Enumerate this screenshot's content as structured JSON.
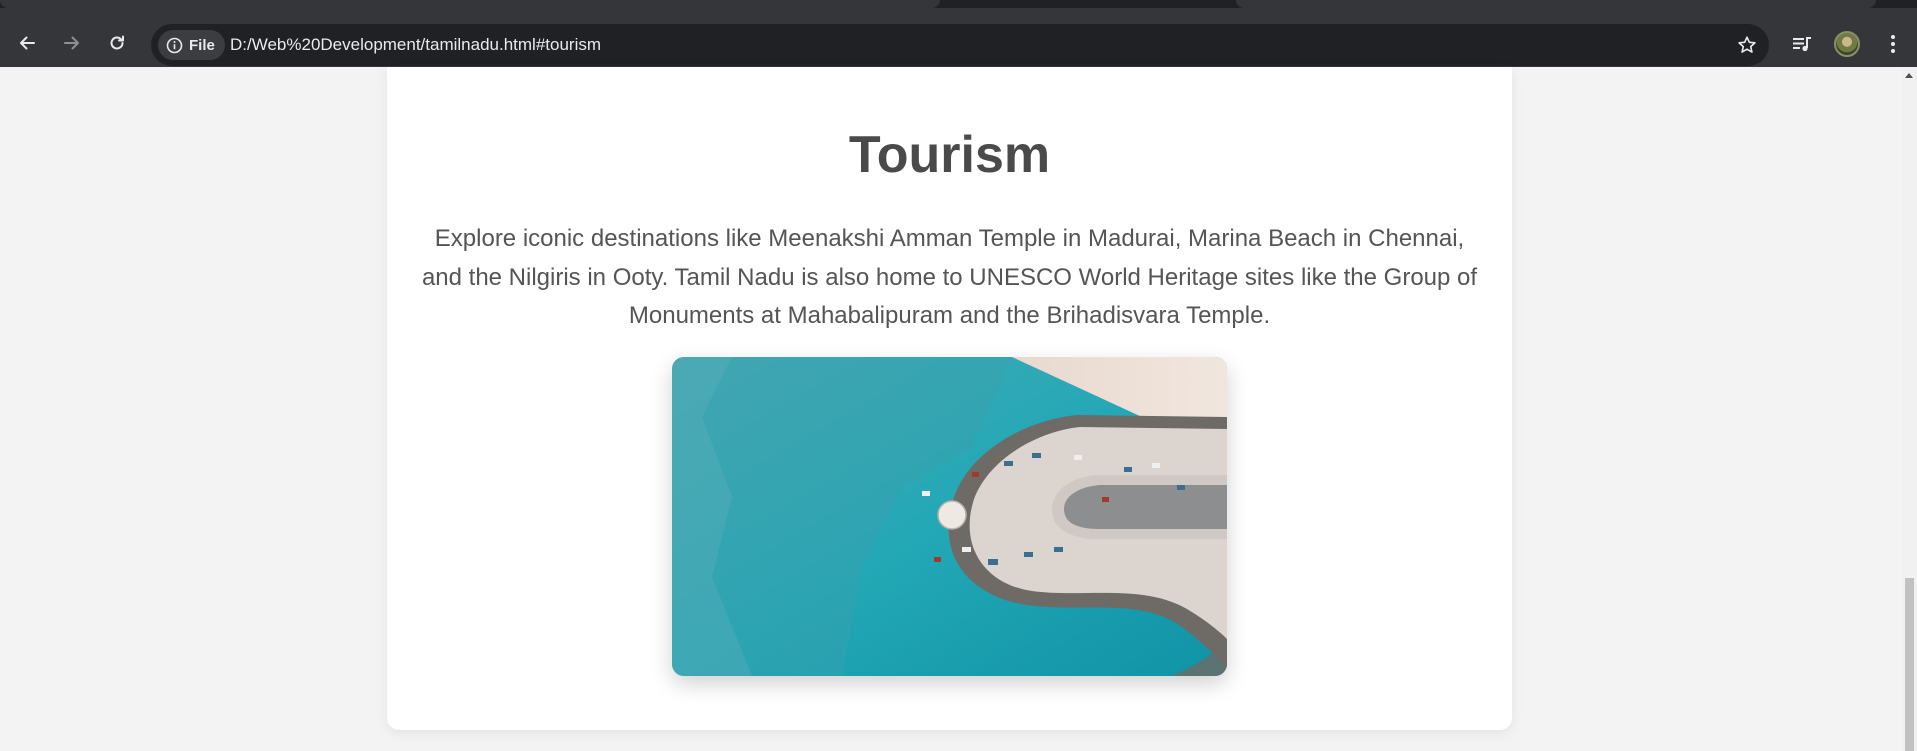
{
  "browser": {
    "address_chip": "File",
    "url": "D:/Web%20Development/tamilnadu.html#tourism",
    "icons": {
      "back": "arrow-left-icon",
      "forward": "arrow-right-icon",
      "reload": "reload-icon",
      "info": "info-icon",
      "bookmark": "star-icon",
      "media": "media-queue-icon",
      "profile": "avatar",
      "menu": "kebab-menu-icon"
    },
    "forward_enabled": false
  },
  "section": {
    "title": "Tourism",
    "description": "Explore iconic destinations like Meenakshi Amman Temple in Madurai, Marina Beach in Chennai, and the Nilgiris in Ooty. Tamil Nadu is also home to UNESCO World Heritage sites like the Group of Monuments at Mahabalipuram and the Brihadisvara Temple.",
    "image_subject": "aerial-view-of-coastal-breakwater"
  },
  "colors": {
    "chrome_bg": "#35363a",
    "omnibox_bg": "#202124",
    "page_bg": "#f3f3f3",
    "card_bg": "#ffffff",
    "title_text": "#4a4a4a",
    "body_text": "#555555",
    "sea": "#2aa5b2"
  }
}
